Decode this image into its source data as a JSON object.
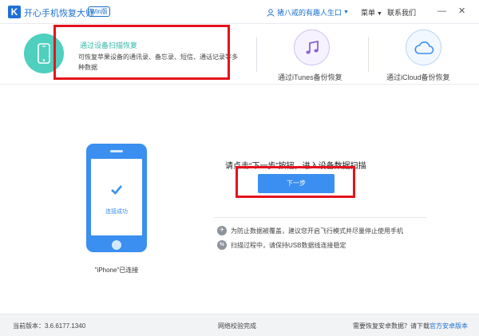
{
  "titlebar": {
    "logo_letter": "K",
    "app_title": "开心手机恢复大师",
    "edition_badge": "Win版",
    "user_name": "猪八戒的有趣人生口",
    "menu_label": "菜单",
    "contact_label": "联系我们",
    "minimize_glyph": "—",
    "close_glyph": "✕"
  },
  "modes": {
    "device_scan": {
      "title": "通过设备扫描恢复",
      "description": "可恢复苹果设备的通讯录、备忘录、短信、通话记录等多种数据"
    },
    "itunes": {
      "label": "通过iTunes备份恢复"
    },
    "icloud": {
      "label": "通过iCloud备份恢复"
    }
  },
  "device": {
    "status_text": "连接成功",
    "device_label": "\"iPhone\"已连接"
  },
  "main": {
    "instruction": "请点击“下一步”按钮，进入设备数据扫描",
    "next_button": "下一步",
    "tips": [
      {
        "icon": "airplane-icon",
        "text": "为防止数据被覆盖，建议您开启飞行模式并尽量停止使用手机"
      },
      {
        "icon": "usb-icon",
        "text": "扫描过程中，请保持USB数据线连接稳定"
      }
    ]
  },
  "footer": {
    "version": "当前版本：3.6.6177.1340",
    "network_status": "网络校验完成",
    "android_prompt": "需要恢复安卓数据？请下载",
    "android_link": "官方安卓版本"
  },
  "colors": {
    "brand_blue": "#3b8ff0",
    "teal_accent": "#4fcfbe",
    "annotation_red": "#e3141d"
  }
}
